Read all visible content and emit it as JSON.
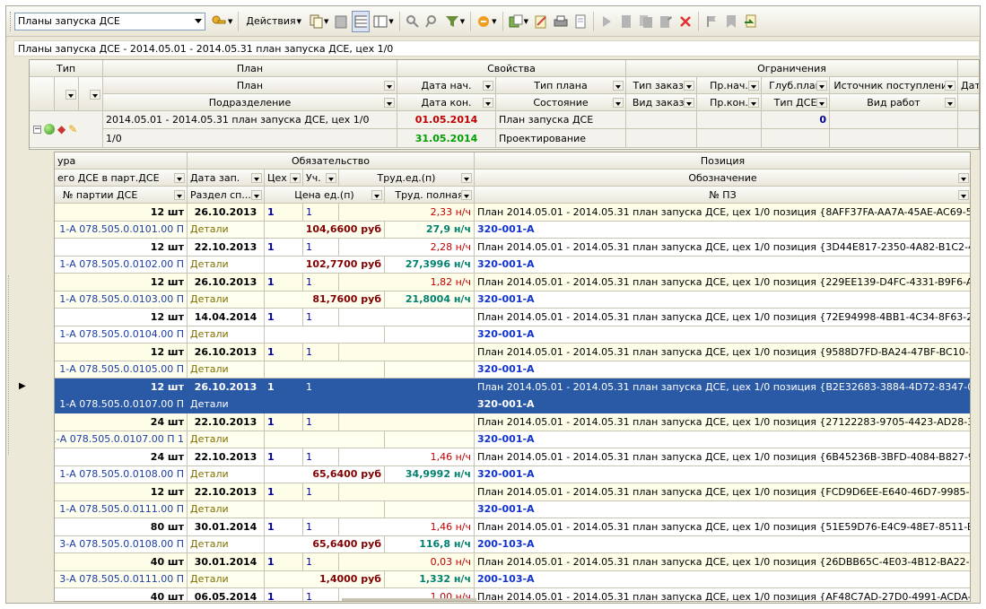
{
  "toolbar": {
    "plans_select": "Планы запуска ДСЕ",
    "actions_label": "Действия"
  },
  "caption": "Планы запуска ДСЕ - 2014.05.01 - 2014.05.31 план запуска ДСЕ, цех 1/0",
  "outer": {
    "group_headers": {
      "type": "Тип",
      "plan": "План",
      "props": "Свойства",
      "limits": "Ограничения"
    },
    "hdr2": {
      "plan": "План",
      "date_start": "Дата нач.",
      "plan_type": "Тип плана",
      "order_type": "Тип заказа",
      "pr_start": "Пр.нач.",
      "depth": "Глуб.план",
      "source": "Источник поступления",
      "date": "Дата"
    },
    "hdr3": {
      "division": "Подразделение",
      "date_end": "Дата кон.",
      "state": "Состояние",
      "order_kind": "Вид заказа",
      "pr_end": "Пр.кон.",
      "dse_type": "Тип ДСЕ",
      "work_kind": "Вид работ"
    },
    "row1": {
      "plan": "2014.05.01 - 2014.05.31 план запуска ДСЕ, цех 1/0",
      "date_start": "01.05.2014",
      "plan_type": "План запуска ДСЕ",
      "dse_type": "0"
    },
    "row2": {
      "division": "1/0",
      "date_end": "31.05.2014",
      "state": "Проектирование"
    }
  },
  "inner": {
    "group_headers": {
      "nom": "ура",
      "oblig": "Обязательство",
      "pos": "Позиция"
    },
    "hdr2": {
      "qty": "его ДСЕ в парт.ДСЕ",
      "date": "Дата зап.",
      "shop": "Цех",
      "uch": "Уч.",
      "labor": "Труд.ед.(п)",
      "designation": "Обозначение"
    },
    "hdr3": {
      "batch": "№ партии ДСЕ",
      "section": "Раздел сп...",
      "price": "Цена ед.(п)",
      "labor_full": "Труд. полная",
      "pz": "№ ПЗ"
    },
    "rows": [
      {
        "qty": "12 шт",
        "date": "26.10.2013",
        "shop": "1",
        "uch": "1",
        "labor": "2,33 н/ч",
        "pos": "План 2014.05.01 - 2014.05.31 план запуска ДСЕ, цех 1/0 позиция {8AFF37FA-AA7A-45AE-AC69-506BE3E84...",
        "batch": "1-А 078.505.0.0101.00 П",
        "section": "Детали",
        "price": "104,6600 руб",
        "labor_full": "27,9 н/ч",
        "pz": "320-001-А"
      },
      {
        "qty": "12 шт",
        "date": "22.10.2013",
        "shop": "1",
        "uch": "1",
        "labor": "2,28 н/ч",
        "pos": "План 2014.05.01 - 2014.05.31 план запуска ДСЕ, цех 1/0 позиция {3D44E817-2350-4A82-B1C2-451CF072B6...",
        "batch": "1-А 078.505.0.0102.00 П",
        "section": "Детали",
        "price": "102,7700 руб",
        "labor_full": "27,3996 н/ч",
        "pz": "320-001-А"
      },
      {
        "qty": "12 шт",
        "date": "26.10.2013",
        "shop": "1",
        "uch": "1",
        "labor": "1,82 н/ч",
        "pos": "План 2014.05.01 - 2014.05.31 план запуска ДСЕ, цех 1/0 позиция {229EE139-D4FC-4331-B9F6-AE12B6346F...",
        "batch": "1-А 078.505.0.0103.00 П",
        "section": "Детали",
        "price": "81,7600 руб",
        "labor_full": "21,8004 н/ч",
        "pz": "320-001-А"
      },
      {
        "qty": "12 шт",
        "date": "14.04.2014",
        "shop": "1",
        "uch": "1",
        "labor": "",
        "pos": "План 2014.05.01 - 2014.05.31 план запуска ДСЕ, цех 1/0 позиция {72E94998-4BB1-4C34-8F63-276669F374...",
        "batch": "1-А 078.505.0.0104.00 П",
        "section": "Детали",
        "price": "",
        "labor_full": "",
        "pz": "320-001-А"
      },
      {
        "qty": "12 шт",
        "date": "26.10.2013",
        "shop": "1",
        "uch": "1",
        "labor": "",
        "pos": "План 2014.05.01 - 2014.05.31 план запуска ДСЕ, цех 1/0 позиция {9588D7FD-BA24-47BF-BC10-231B5C8743...",
        "batch": "1-А 078.505.0.0105.00 П",
        "section": "Детали",
        "price": "",
        "labor_full": "",
        "pz": "320-001-А"
      },
      {
        "qty": "12 шт",
        "date": "26.10.2013",
        "shop": "1",
        "uch": "1",
        "labor": "",
        "pos": "План 2014.05.01 - 2014.05.31 план запуска ДСЕ, цех 1/0 позиция {B2E32683-3884-4D72-8347-0C48737D16...",
        "batch": "1-А 078.505.0.0107.00 П",
        "section": "Детали",
        "price": "",
        "labor_full": "",
        "pz": "320-001-А"
      },
      {
        "qty": "24 шт",
        "date": "22.10.2013",
        "shop": "1",
        "uch": "1",
        "labor": "",
        "pos": "План 2014.05.01 - 2014.05.31 план запуска ДСЕ, цех 1/0 позиция {27122283-9705-4423-AD28-3C93F06ECA...",
        "batch": "1-А 078.505.0.0107.00 П 1",
        "section": "Детали",
        "price": "",
        "labor_full": "",
        "pz": "320-001-А"
      },
      {
        "qty": "24 шт",
        "date": "22.10.2013",
        "shop": "1",
        "uch": "1",
        "labor": "1,46 н/ч",
        "pos": "План 2014.05.01 - 2014.05.31 план запуска ДСЕ, цех 1/0 позиция {6B45236B-3BFD-4084-B827-93C8395EEE...",
        "batch": "1-А 078.505.0.0108.00 П",
        "section": "Детали",
        "price": "65,6400 руб",
        "labor_full": "34,9992 н/ч",
        "pz": "320-001-А"
      },
      {
        "qty": "12 шт",
        "date": "22.10.2013",
        "shop": "1",
        "uch": "1",
        "labor": "",
        "pos": "План 2014.05.01 - 2014.05.31 план запуска ДСЕ, цех 1/0 позиция {FCD9D6EE-E640-46D7-9985-F9369D128F...",
        "batch": "1-А 078.505.0.0111.00 П",
        "section": "Детали",
        "price": "",
        "labor_full": "",
        "pz": "320-001-А"
      },
      {
        "qty": "80 шт",
        "date": "30.01.2014",
        "shop": "1",
        "uch": "1",
        "labor": "1,46 н/ч",
        "pos": "План 2014.05.01 - 2014.05.31 план запуска ДСЕ, цех 1/0 позиция {51E59D76-E4C9-48E7-8511-B378514099...",
        "batch": "3-А 078.505.0.0108.00 П",
        "section": "Детали",
        "price": "65,6400 руб",
        "labor_full": "116,8 н/ч",
        "pz": "200-103-А"
      },
      {
        "qty": "40 шт",
        "date": "30.01.2014",
        "shop": "1",
        "uch": "1",
        "labor": "0,03 н/ч",
        "pos": "План 2014.05.01 - 2014.05.31 план запуска ДСЕ, цех 1/0 позиция {26DBB65C-4E03-4B12-BA22-971FC08343...",
        "batch": "3-А 078.505.0.0111.00 П",
        "section": "Детали",
        "price": "1,4000 руб",
        "labor_full": "1,332 н/ч",
        "pz": "200-103-А"
      },
      {
        "qty": "40 шт",
        "date": "06.05.2014",
        "shop": "1",
        "uch": "1",
        "labor": "1,00 н/ч",
        "pos": "План 2014.05.01 - 2014.05.31 план запуска ДСЕ, цех 1/0 позиция {AF48C7AD-27D0-4991-ACDA-9D982D19F...",
        "batch": "",
        "section": "",
        "price": "",
        "labor_full": "",
        "pz": ""
      }
    ]
  }
}
